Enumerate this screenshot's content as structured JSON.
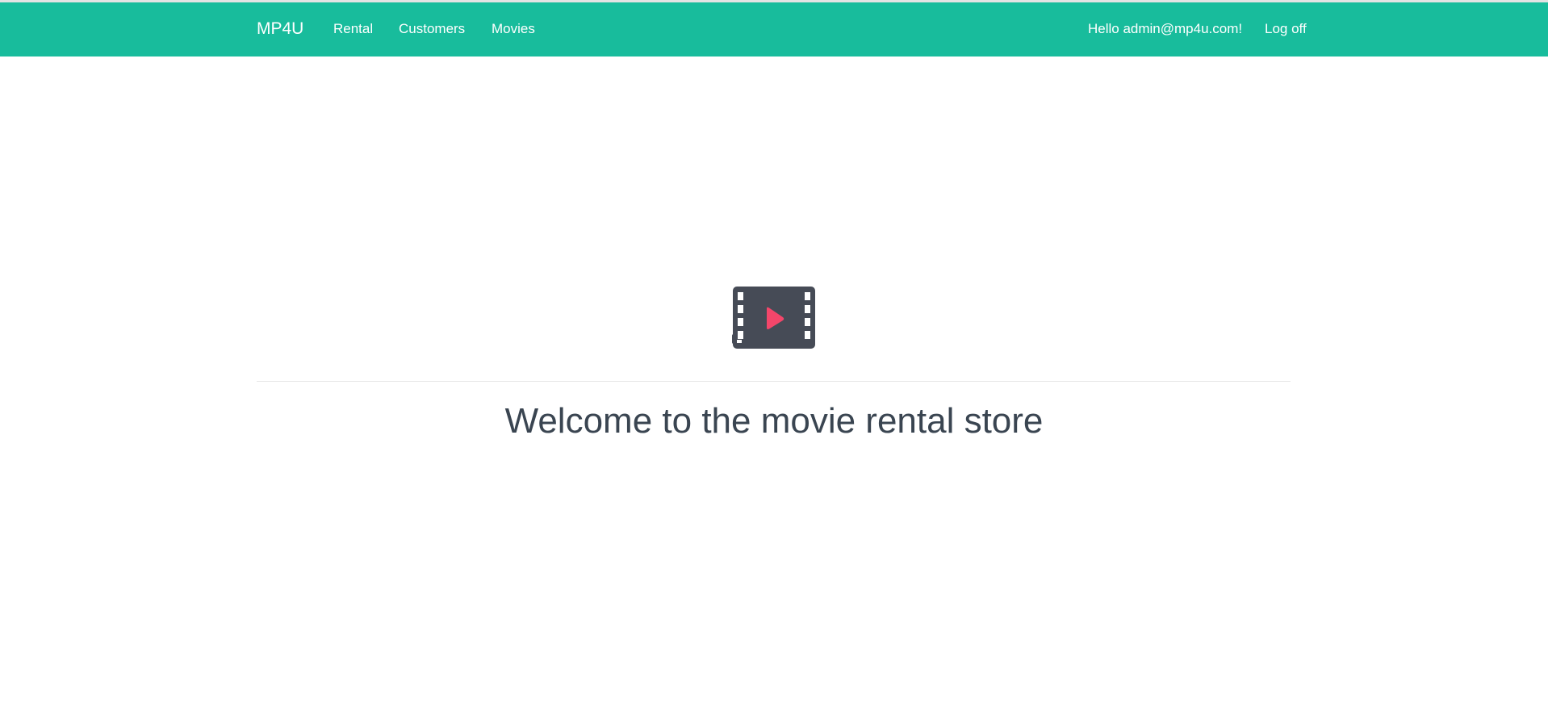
{
  "navbar": {
    "brand": "MP4U",
    "links": [
      {
        "label": "Rental"
      },
      {
        "label": "Customers"
      },
      {
        "label": "Movies"
      }
    ],
    "greeting": "Hello admin@mp4u.com!",
    "logoff": "Log off"
  },
  "hero": {
    "icon": "film-play-icon",
    "heading": "Welcome to the movie rental store"
  },
  "colors": {
    "navbar_bg": "#18bc9c",
    "icon_body": "#464b56",
    "play_accent": "#f4466a",
    "heading_text": "#3a4551"
  }
}
